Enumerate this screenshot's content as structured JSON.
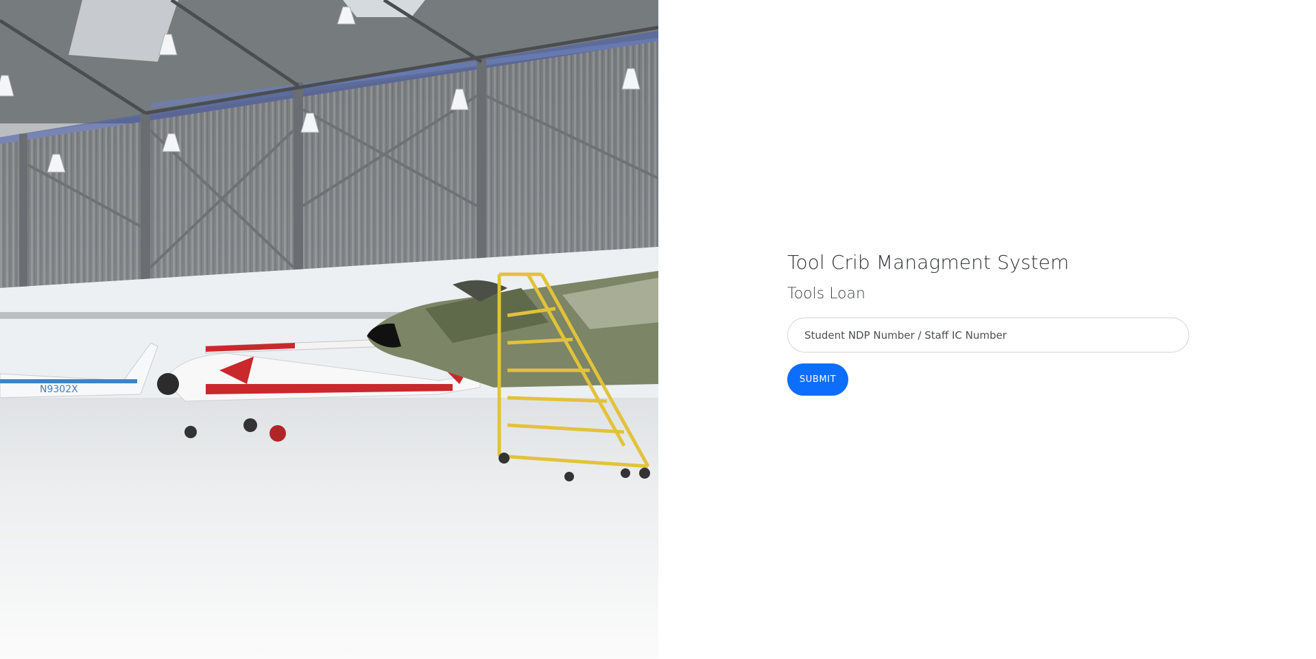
{
  "app": {
    "title": "Tool Crib Managment System",
    "section_title": "Tools Loan"
  },
  "login_form": {
    "id_input_placeholder": "Student NDP Number / Staff IC Number",
    "id_input_value": "",
    "submit_label": "SUBMIT"
  },
  "hero": {
    "description_icon": "hangar-photo",
    "aircraft_registration": "N9302X"
  },
  "colors": {
    "accent": "#0d6efd",
    "input_border": "#cfd4d9",
    "title_text": "#2f3236"
  }
}
